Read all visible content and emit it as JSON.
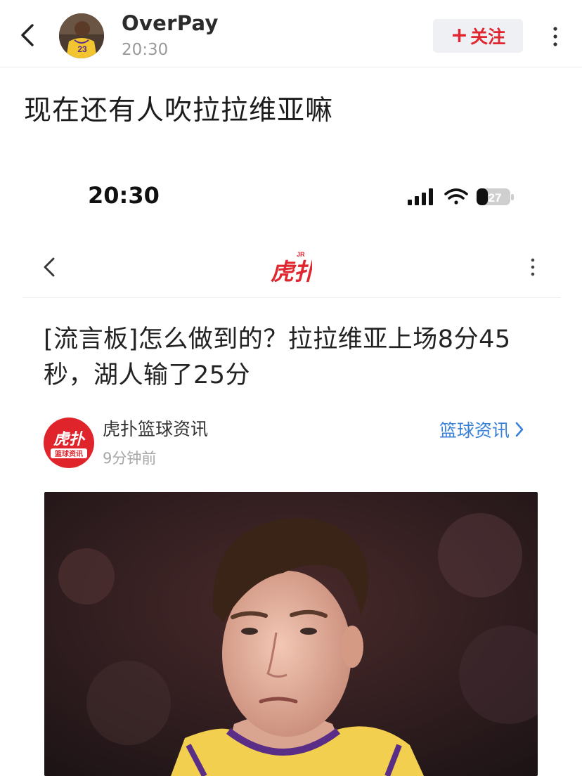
{
  "header": {
    "username": "OverPay",
    "time": "20:30",
    "follow_label": "关注",
    "follow_plus": "+"
  },
  "post": {
    "title": "现在还有人吹拉拉维亚嘛"
  },
  "embedded": {
    "status_time": "20:30",
    "battery": "27",
    "app_logo_text": "虎扑",
    "app_logo_badge": "JR",
    "article_title": "[流言板]怎么做到的？拉拉维亚上场8分45秒，湖人输了25分",
    "source": {
      "name": "虎扑篮球资讯",
      "time": "9分钟前",
      "category_link": "篮球资讯",
      "logo_text": "虎扑",
      "logo_sub": "篮球资讯"
    },
    "jersey_number": "23"
  },
  "colors": {
    "accent_red": "#e0262f",
    "link_blue": "#3a82d8",
    "lakers_gold": "#f2cf4e",
    "lakers_purple": "#5a2e86"
  },
  "icons": [
    "back-arrow-icon",
    "more-vertical-icon",
    "signal-icon",
    "wifi-icon",
    "battery-icon",
    "chevron-right-icon"
  ]
}
